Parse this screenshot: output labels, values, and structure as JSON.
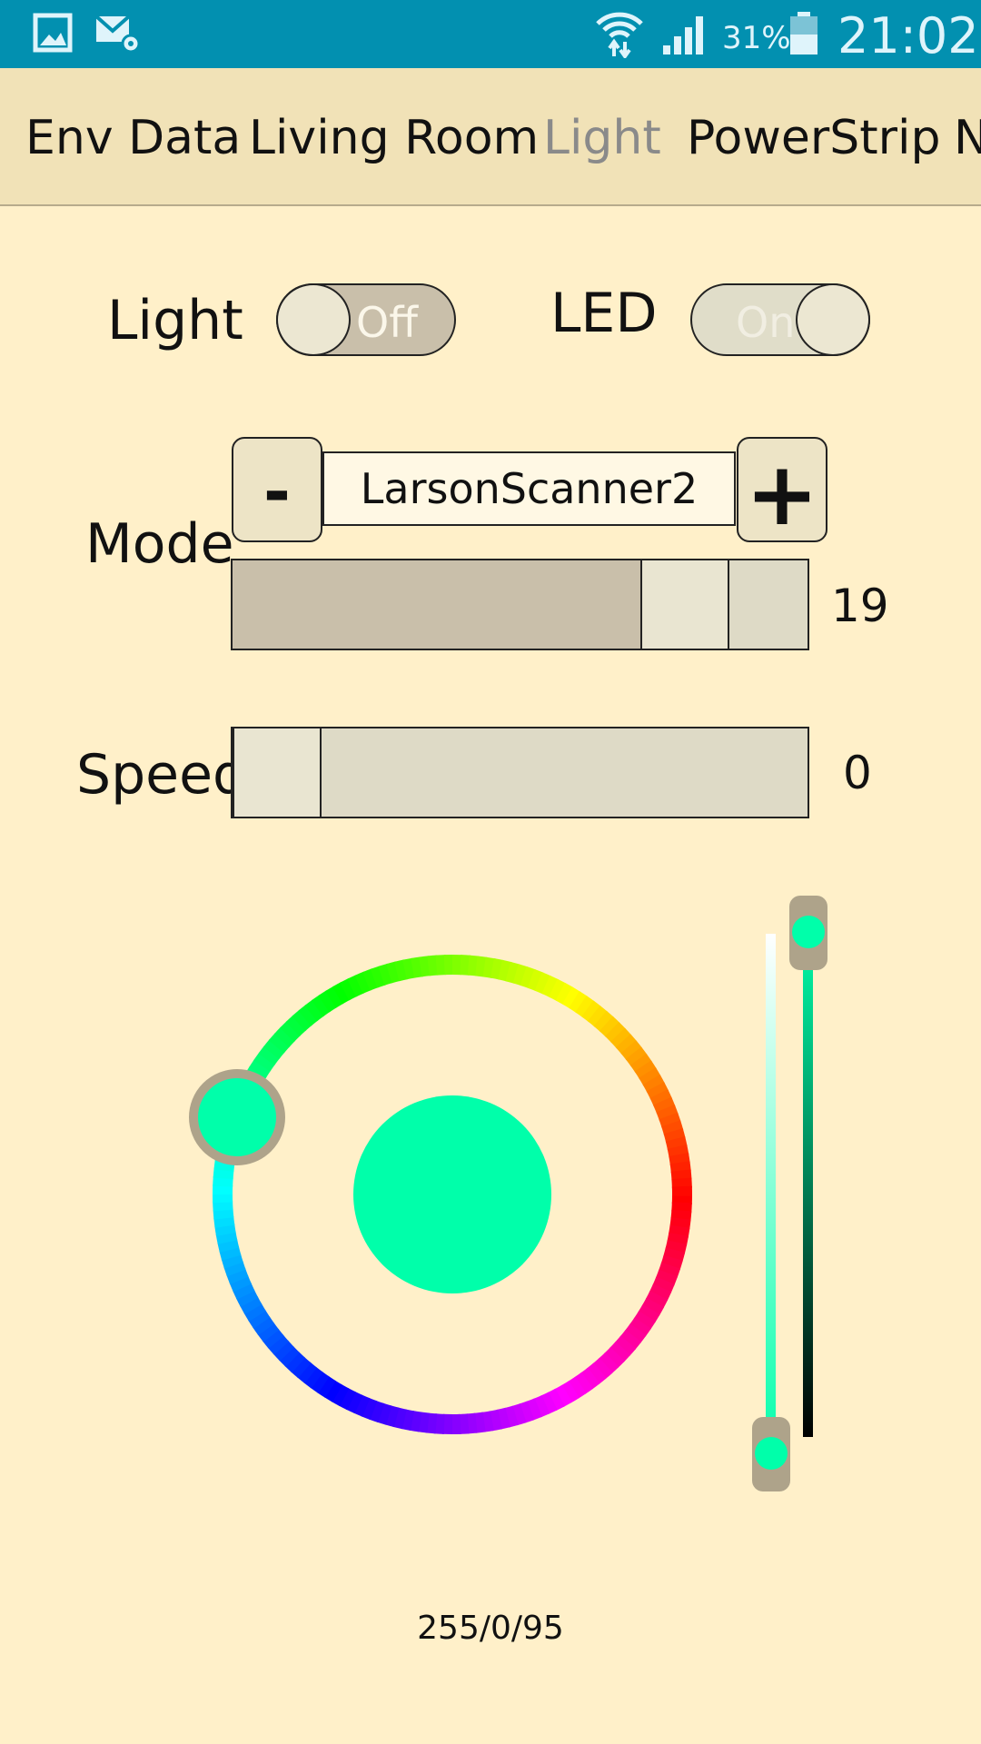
{
  "status_bar": {
    "battery": "31%",
    "time": "21:02",
    "icons": [
      "gallery-icon",
      "mail-settings-icon",
      "wifi-icon",
      "signal-icon",
      "battery-icon"
    ]
  },
  "tabs": [
    {
      "label": "Env Data",
      "active": false
    },
    {
      "label": "Living Room",
      "active": false
    },
    {
      "label": "Light",
      "active": true
    },
    {
      "label": "PowerStrip",
      "active": false
    },
    {
      "label": "N",
      "active": false
    }
  ],
  "light": {
    "label": "Light",
    "toggle_text": "Off",
    "state": false
  },
  "led": {
    "label": "LED",
    "toggle_text": "On",
    "state": true
  },
  "mode": {
    "label": "Mode",
    "minus": "-",
    "plus": "+",
    "value": "LarsonScanner2",
    "slider_value": "19",
    "slider_fraction": 0.84
  },
  "speed": {
    "label": "Speed",
    "value": "0",
    "slider_fraction": 0.0
  },
  "color_picker": {
    "selected_color": "#00ffaa",
    "hue_deg": 150,
    "brightness_fraction": 1.0,
    "saturation_fraction": 0.0
  },
  "footer": {
    "rgb_text": "255/0/95"
  },
  "colors": {
    "status_bar": "#0290b0",
    "tab_bar": "#f1e2b7",
    "background": "#fff0c9",
    "slider_fill": "#c9bfaa"
  }
}
